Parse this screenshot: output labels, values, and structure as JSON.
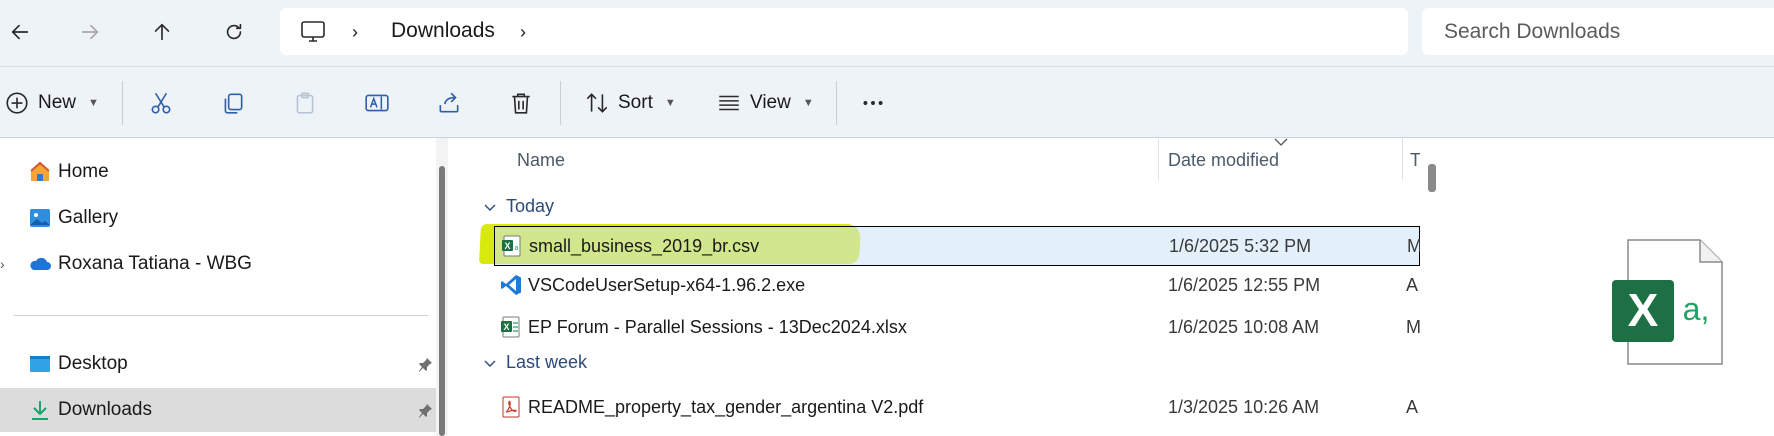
{
  "nav": {
    "back_icon": "arrow-left-icon",
    "forward_icon": "arrow-right-icon",
    "up_icon": "arrow-up-icon",
    "refresh_icon": "refresh-icon"
  },
  "address": {
    "root_icon": "this-pc-icon",
    "current_folder": "Downloads"
  },
  "search": {
    "placeholder": "Search Downloads"
  },
  "toolbar": {
    "new_label": "New",
    "sort_label": "Sort",
    "view_label": "View",
    "icons": [
      "plus-circle-icon",
      "cut-icon",
      "copy-icon",
      "paste-icon",
      "rename-icon",
      "share-icon",
      "delete-icon",
      "sort-icon",
      "view-icon",
      "more-icon"
    ]
  },
  "sidebar": {
    "items": [
      {
        "label": "Home",
        "icon": "home-icon"
      },
      {
        "label": "Gallery",
        "icon": "gallery-icon"
      },
      {
        "label": "Roxana Tatiana - WBG",
        "icon": "onedrive-cloud-icon"
      },
      {
        "label": "Desktop",
        "icon": "desktop-folder-icon",
        "pinned": true
      },
      {
        "label": "Downloads",
        "icon": "download-icon",
        "pinned": true,
        "selected": true
      }
    ]
  },
  "file_list": {
    "columns": [
      "Name",
      "Date modified",
      "T"
    ],
    "groups": [
      {
        "label": "Today",
        "files": [
          {
            "name": "small_business_2019_br.csv",
            "date": "1/6/2025 5:32 PM",
            "type": "M",
            "icon": "excel-csv-icon",
            "selected": true
          },
          {
            "name": "VSCodeUserSetup-x64-1.96.2.exe",
            "date": "1/6/2025 12:55 PM",
            "type": "A",
            "icon": "vscode-icon"
          },
          {
            "name": "EP Forum - Parallel Sessions - 13Dec2024.xlsx",
            "date": "1/6/2025 10:08 AM",
            "type": "M",
            "icon": "excel-icon"
          }
        ]
      },
      {
        "label": "Last week",
        "files": [
          {
            "name": "README_property_tax_gender_argentina V2.pdf",
            "date": "1/3/2025 10:26 AM",
            "type": "A",
            "icon": "pdf-icon"
          }
        ]
      }
    ]
  },
  "preview": {
    "icon": "excel-csv-file-icon",
    "icon_badge": "X",
    "icon_text": "a,"
  },
  "colors": {
    "selection": "#cce4f7",
    "highlighter": "#d6e800",
    "excel_green": "#1d7044",
    "group_header": "#2c4a7a"
  }
}
